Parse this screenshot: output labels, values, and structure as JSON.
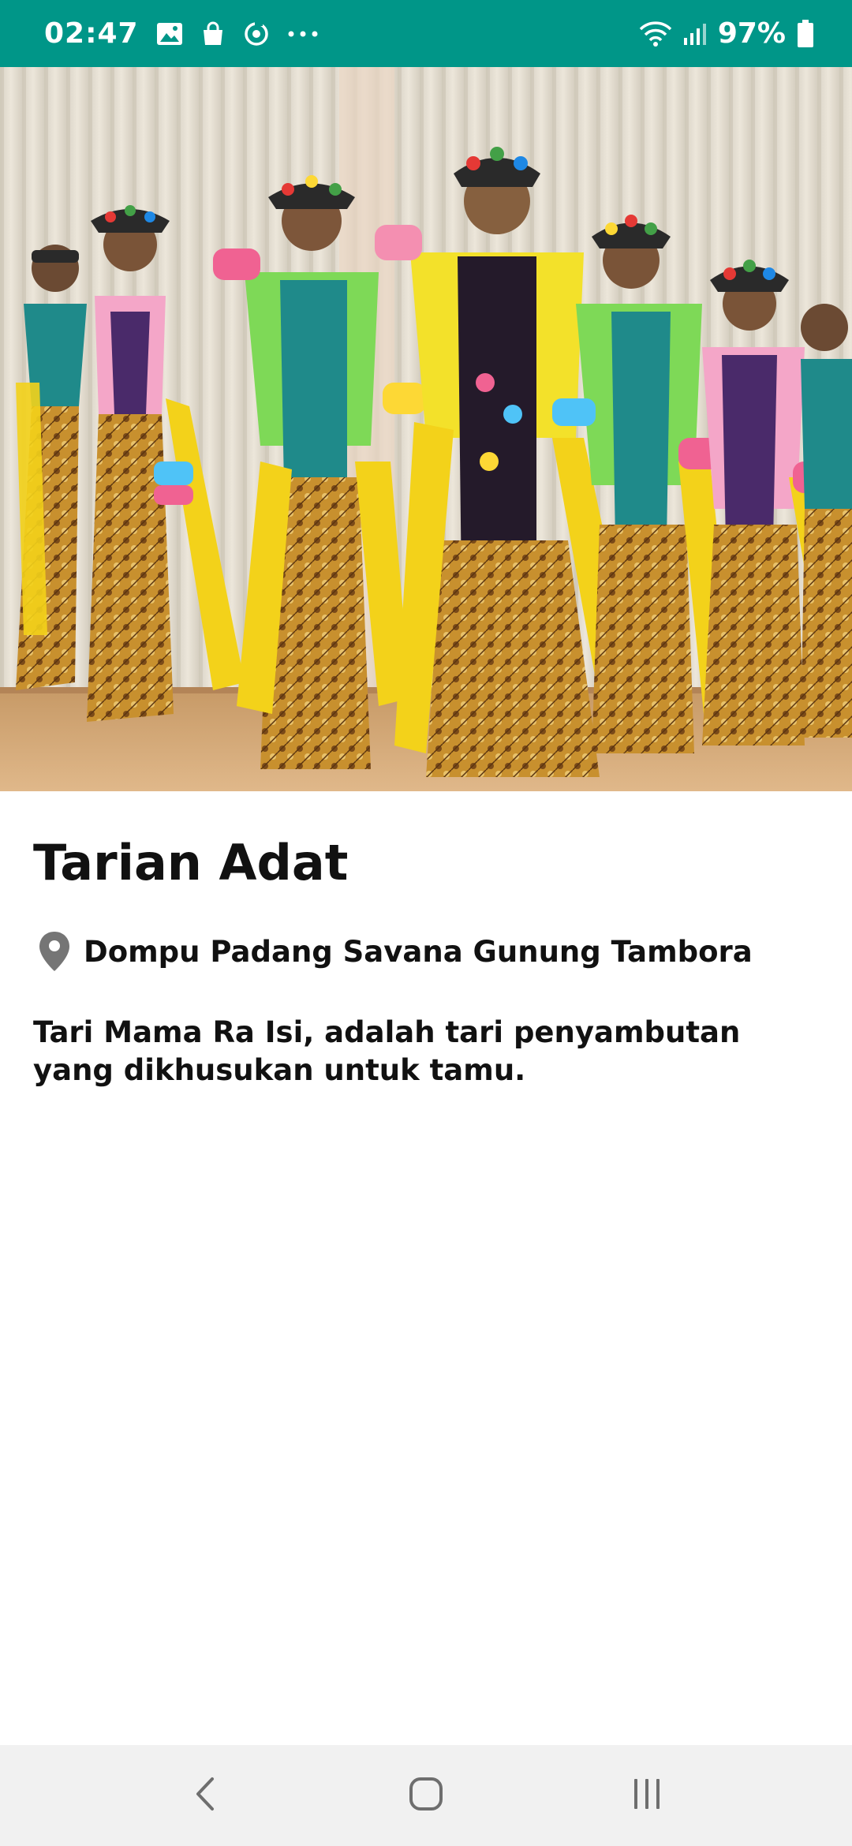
{
  "status_bar": {
    "time": "02:47",
    "battery_percent": "97%",
    "icons": [
      "image-icon",
      "shopping-bag-icon",
      "sync-icon",
      "more-dots-icon",
      "wifi-icon",
      "signal-icon",
      "battery-icon"
    ],
    "background_color": "#009688"
  },
  "detail": {
    "image_alt": "hero-photo",
    "title": "Tarian Adat",
    "location": "Dompu Padang Savana Gunung Tambora",
    "location_icon": "location-pin-icon",
    "description": "Tari Mama Ra Isi, adalah tari penyambutan yang dikhusukan untuk tamu."
  },
  "nav_bar": {
    "buttons": [
      "back-icon",
      "home-icon",
      "recents-icon"
    ]
  }
}
